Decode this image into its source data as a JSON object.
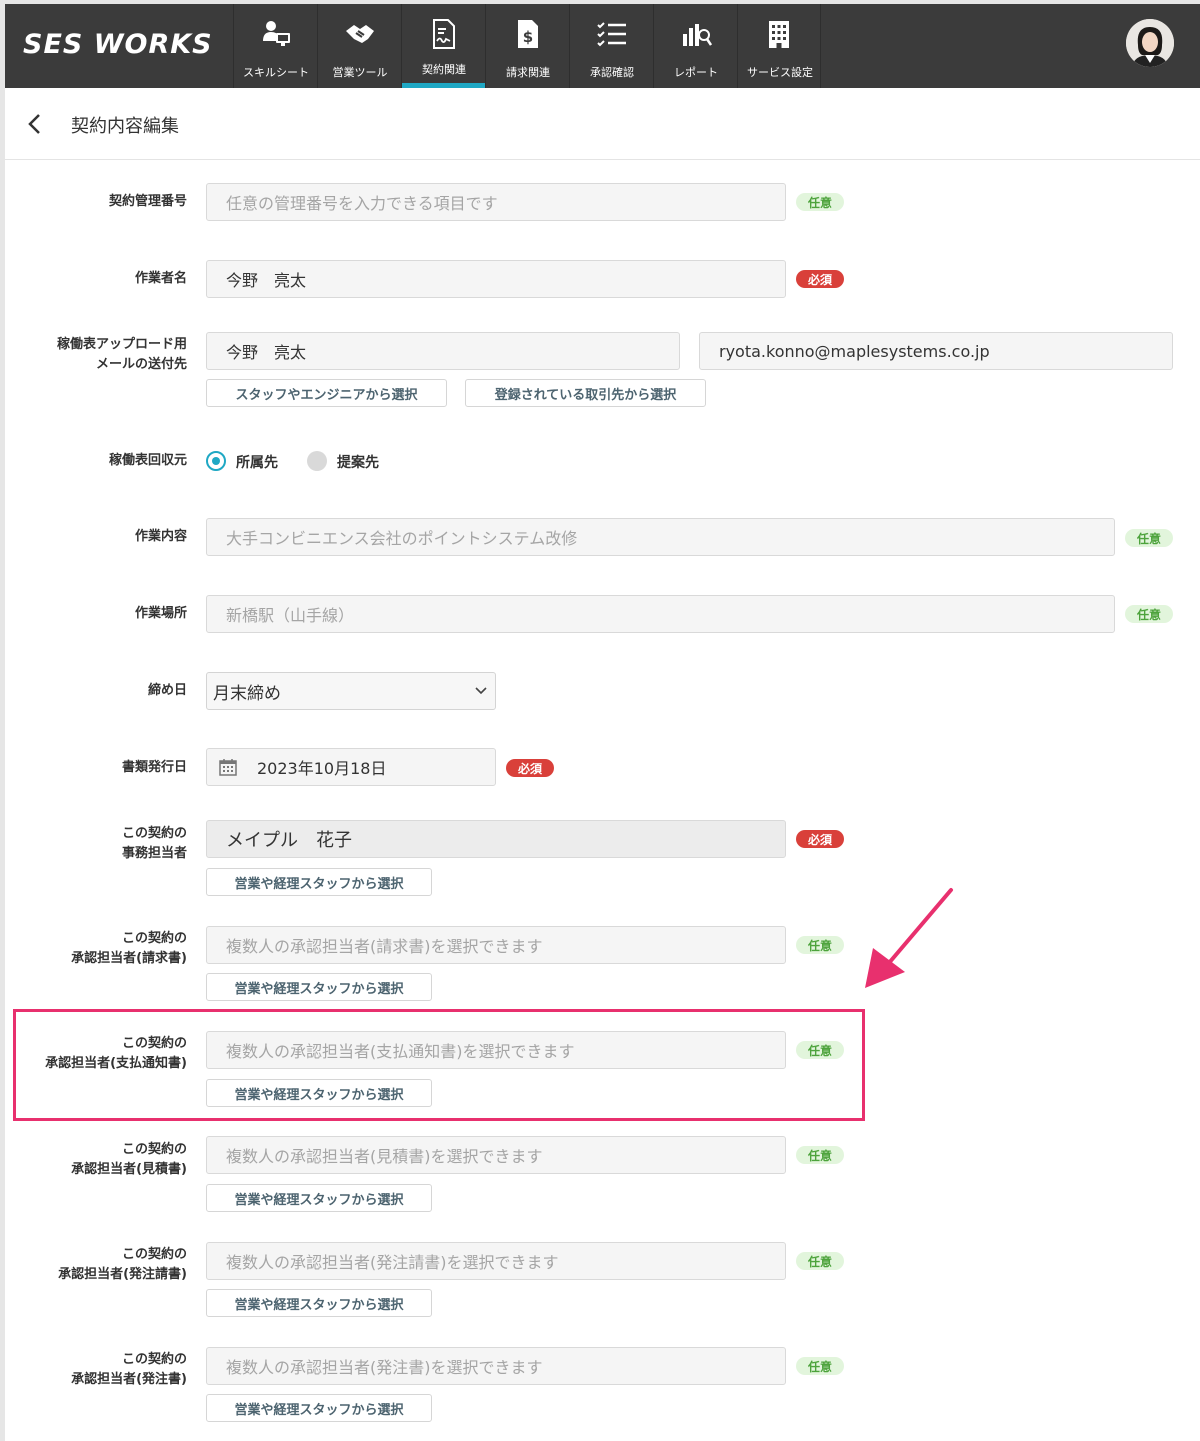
{
  "app": {
    "logo": "SES WORKS"
  },
  "nav": [
    {
      "label": "スキルシート",
      "icon": "person-computer-icon"
    },
    {
      "label": "営業ツール",
      "icon": "handshake-icon"
    },
    {
      "label": "契約関連",
      "icon": "contract-document-icon",
      "active": true
    },
    {
      "label": "請求関連",
      "icon": "invoice-document-icon"
    },
    {
      "label": "承認確認",
      "icon": "checklist-icon"
    },
    {
      "label": "レポート",
      "icon": "report-chart-icon"
    },
    {
      "label": "サービス設定",
      "icon": "building-icon"
    }
  ],
  "page": {
    "title": "契約内容編集"
  },
  "badges": {
    "optional": "任意",
    "required": "必須"
  },
  "form": {
    "contract_no": {
      "label": "契約管理番号",
      "placeholder": "任意の管理番号を入力できる項目です"
    },
    "worker_name": {
      "label": "作業者名",
      "value": "今野　亮太"
    },
    "timesheet_email": {
      "label_line1": "稼働表アップロード用",
      "label_line2": "メールの送付先",
      "name_value": "今野　亮太",
      "email_value": "ryota.konno@maplesystems.co.jp",
      "btn_staff": "スタッフやエンジニアから選択",
      "btn_client": "登録されている取引先から選択"
    },
    "timesheet_collect": {
      "label": "稼働表回収元",
      "option1": "所属先",
      "option2": "提案先"
    },
    "work_content": {
      "label": "作業内容",
      "placeholder": "大手コンビニエンス会社のポイントシステム改修"
    },
    "work_place": {
      "label": "作業場所",
      "placeholder": "新橋駅（山手線）"
    },
    "closing_day": {
      "label": "締め日",
      "value": "月末締め"
    },
    "issue_date": {
      "label": "書類発行日",
      "value": "2023年10月18日"
    },
    "office_person": {
      "label_line1": "この契約の",
      "label_line2": "事務担当者",
      "value": "メイプル　花子"
    },
    "approver_invoice": {
      "label_line1": "この契約の",
      "label_line2": "承認担当者(請求書)",
      "placeholder": "複数人の承認担当者(請求書)を選択できます"
    },
    "approver_payment": {
      "label_line1": "この契約の",
      "label_line2": "承認担当者(支払通知書)",
      "placeholder": "複数人の承認担当者(支払通知書)を選択できます"
    },
    "approver_estimate": {
      "label_line1": "この契約の",
      "label_line2": "承認担当者(見積書)",
      "placeholder": "複数人の承認担当者(見積書)を選択できます"
    },
    "approver_order_ack": {
      "label_line1": "この契約の",
      "label_line2": "承認担当者(発注請書)",
      "placeholder": "複数人の承認担当者(発注請書)を選択できます"
    },
    "approver_order": {
      "label_line1": "この契約の",
      "label_line2": "承認担当者(発注書)",
      "placeholder": "複数人の承認担当者(発注書)を選択できます"
    },
    "select_staff_btn": "営業や経理スタッフから選択"
  },
  "colors": {
    "header": "#3b3b3b",
    "accent": "#1fa8c4",
    "highlight": "#e8306e",
    "required": "#d9403a",
    "optional_bg": "#e2f5dc",
    "optional_fg": "#4da33c"
  }
}
